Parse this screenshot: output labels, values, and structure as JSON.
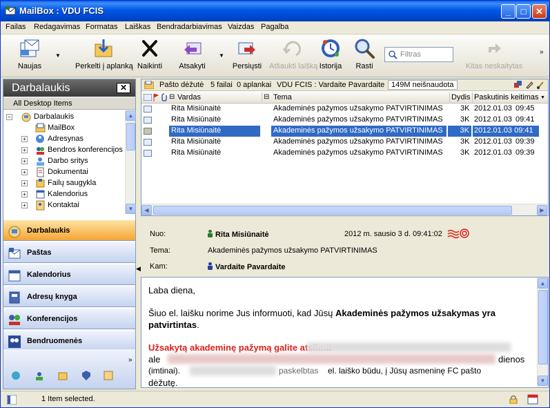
{
  "window": {
    "title": "MailBox : VDU FCIS",
    "min": "_",
    "max": "□",
    "close": "✕"
  },
  "menu": [
    "Failas",
    "Redagavimas",
    "Formatas",
    "Laiškas",
    "Bendradarbiavimas",
    "Vaizdas",
    "Pagalba"
  ],
  "toolbar": {
    "new": "Naujas",
    "move": "Perkelti į aplanką",
    "delete": "Naikinti",
    "reply": "Atsakyti",
    "forward": "Persiųsti",
    "recall": "Atšaukti laišką",
    "history": "Istorija",
    "find": "Rasti",
    "filter_placeholder": "Filtras",
    "next_unread": "Kitas neskaitytas",
    "dropdown_arrow": "▼",
    "more": "»"
  },
  "left": {
    "title": "Darbalaukis",
    "close": "✕",
    "sub": "All Desktop Items",
    "tree": [
      {
        "label": "Darbalaukis",
        "icon": "desktop-icon",
        "exp": "−"
      },
      {
        "label": "MailBox",
        "icon": "mailbox-icon",
        "exp": ""
      },
      {
        "label": "Adresynas",
        "icon": "address-book-icon",
        "exp": "+"
      },
      {
        "label": "Bendros konferencijos",
        "icon": "conference-icon",
        "exp": "+"
      },
      {
        "label": "Darbo sritys",
        "icon": "workspace-icon",
        "exp": "+"
      },
      {
        "label": "Dokumentai",
        "icon": "documents-icon",
        "exp": "+"
      },
      {
        "label": "Failų saugykla",
        "icon": "file-storage-icon",
        "exp": "+"
      },
      {
        "label": "Kalendorius",
        "icon": "calendar-icon",
        "exp": "+"
      },
      {
        "label": "Kontaktai",
        "icon": "contacts-icon",
        "exp": "+"
      }
    ],
    "nav": [
      "Darbalaukis",
      "Paštas",
      "Kalendorius",
      "Adresų knyga",
      "Konferencijos",
      "Bendruomenės"
    ],
    "more": "»"
  },
  "list": {
    "folder": "Pašto dėžutė",
    "files": "5 failai",
    "folders": "0 aplankai",
    "path": "VDU FCIS : Vardaite Pavardaite",
    "unread": "149M neišnaudota",
    "columns": {
      "name": "Vardas",
      "subject": "Tema",
      "size": "Dydis",
      "modified": "Paskutinis keitimas"
    },
    "rows": [
      {
        "name": "Rita Misiūnaitė",
        "subject": "Akademinės pažymos užsakymo PATVIRTINIMAS",
        "size": "3K",
        "date": "2012.01.03",
        "time": "09:45"
      },
      {
        "name": "Rita Misiūnaitė",
        "subject": "Akademinės pažymos užsakymo PATVIRTINIMAS",
        "size": "3K",
        "date": "2012.01.03",
        "time": "09:41"
      },
      {
        "name": "Rita Misiūnaitė",
        "subject": "Akademinės pažymos užsakymo PATVIRTINIMAS",
        "size": "3K",
        "date": "2012.01.03",
        "time": "09:41"
      },
      {
        "name": "Rita Misiūnaitė",
        "subject": "Akademinės pažymos užsakymo PATVIRTINIMAS",
        "size": "3K",
        "date": "2012.01.03",
        "time": "09:39"
      },
      {
        "name": "Rita Misiūnaitė",
        "subject": "Akademinės pažymos užsakymo PATVIRTINIMAS",
        "size": "3K",
        "date": "2012.01.03",
        "time": "09:39"
      }
    ],
    "selected_row": 3
  },
  "preview": {
    "from_label": "Nuo:",
    "from": "Rita Misiūnaitė",
    "date": "2012 m. sausio 3 d. 09:41:02",
    "subject_label": "Tema:",
    "subject": "Akademinės pažymos užsakymo PATVIRTINIMAS",
    "to_label": "Kam:",
    "to": "Vardaite Pavardaite",
    "body_greeting": "Laba diena,",
    "body_intro": "Šiuo el. laišku norime Jus informuoti, kad Jūsų ",
    "body_intro_bold": "Akademinės pažymos užsakymas yra patvirtintas",
    "body_intro_end": ".",
    "body_red": "Užsakytą akademinę pažymą galite atsiimti",
    "body_line2_a": "ale",
    "body_line2_b": "dienos",
    "body_line3_a": "(imtinai).",
    "body_line3_b": "paskelbtas",
    "body_line3_c": "el. laiško būdu, į Jūsų asmeninę FC pašto",
    "body_line4": "dėžutę."
  },
  "status": {
    "text": "1 Item selected."
  },
  "colors": {
    "selection": "#316ac5",
    "accent": "#0058e8",
    "active_nav": "#f6a533",
    "red_text": "#e0201b"
  }
}
